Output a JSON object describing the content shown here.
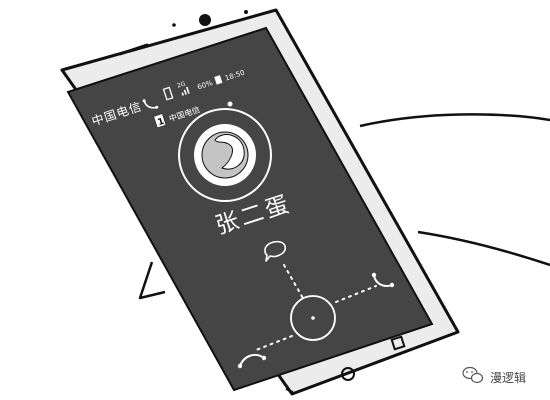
{
  "status_bar": {
    "carrier": "中国电信",
    "network": "2G",
    "battery": "60%",
    "time": "18:50"
  },
  "call": {
    "sim_number": "1",
    "sim_carrier": "中国电信",
    "caller_name": "张二蛋"
  },
  "icons": {
    "phone_status": "phone-icon",
    "message": "message-bubble-icon",
    "answer": "answer-call-icon",
    "decline": "decline-call-icon",
    "avatar": "default-avatar-icon",
    "vibrate": "vibrate-icon",
    "signal": "signal-bars-icon",
    "battery": "battery-icon"
  },
  "nav": {
    "home": "home-button",
    "recent": "recent-apps-button"
  },
  "watermark": {
    "text": "漫逻辑",
    "icon": "wechat-icon"
  }
}
